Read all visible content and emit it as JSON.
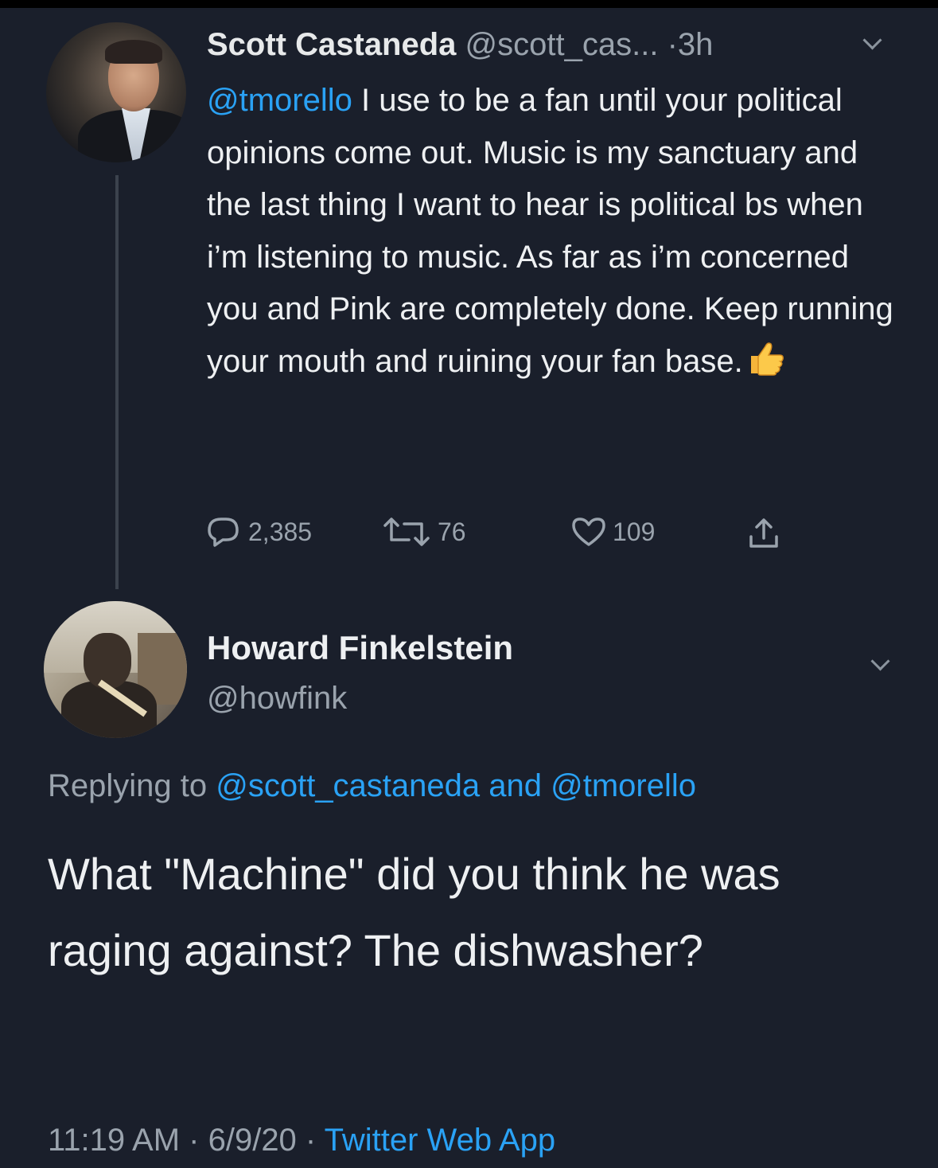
{
  "tweet1": {
    "name": "Scott Castaneda",
    "handle": "@scott_cas...",
    "separator": "·",
    "time": "3h",
    "mention": "@tmorello",
    "text": " I use to be a fan until your political opinions come out. Music is my sanctuary and the last thing I want to hear is political bs when i’m listening to music. As far as i’m concerned you and Pink are completely done. Keep running your mouth and ruining your fan base.",
    "emoji": "thumbs-up",
    "replies": "2,385",
    "retweets": "76",
    "likes": "109"
  },
  "tweet2": {
    "name": "Howard Finkelstein",
    "handle": "@howfink",
    "replying_prefix": "Replying to ",
    "replying_to_1": "@scott_castaneda",
    "replying_and": " and ",
    "replying_to_2": "@tmorello",
    "text": "What \"Machine\" did you think he was raging against? The dishwasher?",
    "time": "11:19 AM",
    "separator": " · ",
    "date": "6/9/20",
    "source": "Twitter Web App"
  },
  "colors": {
    "background": "#1a1f2b",
    "link": "#2aa2f5",
    "muted": "#9aa3ad",
    "text": "#eef0f2"
  }
}
